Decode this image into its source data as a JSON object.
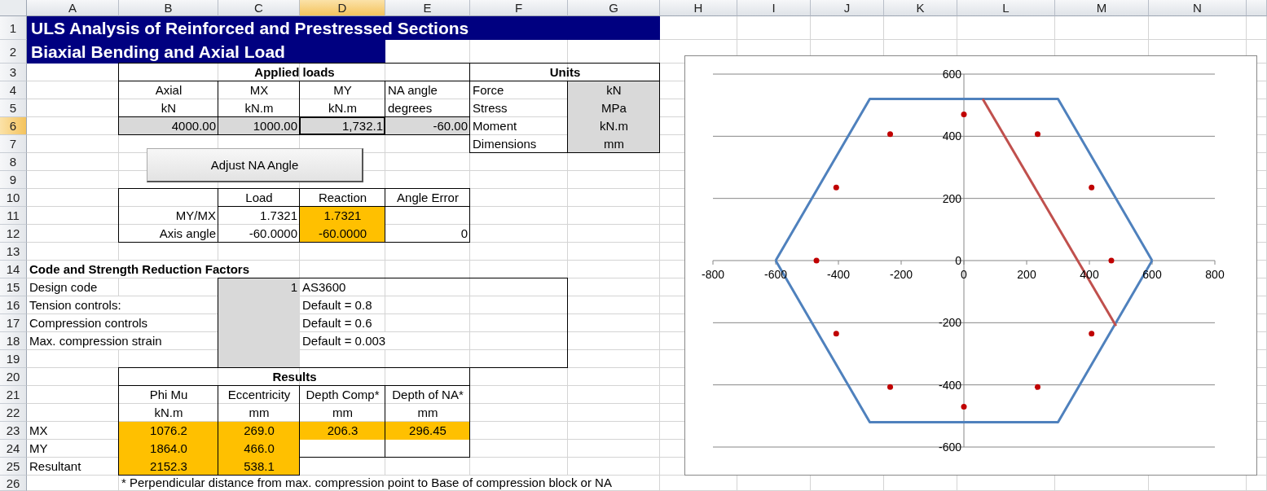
{
  "column_headers": [
    {
      "label": "A",
      "selected": false
    },
    {
      "label": "B",
      "selected": false
    },
    {
      "label": "C",
      "selected": false
    },
    {
      "label": "D",
      "selected": true
    },
    {
      "label": "E",
      "selected": false
    },
    {
      "label": "F",
      "selected": false
    },
    {
      "label": "G",
      "selected": false
    },
    {
      "label": "H",
      "selected": false
    },
    {
      "label": "I",
      "selected": false
    },
    {
      "label": "J",
      "selected": false
    },
    {
      "label": "K",
      "selected": false
    },
    {
      "label": "L",
      "selected": false
    },
    {
      "label": "M",
      "selected": false
    },
    {
      "label": "N",
      "selected": false
    }
  ],
  "rows": [
    {
      "label": "1",
      "selected": false,
      "cells": {
        "A": {
          "text": "ULS Analysis of Reinforced and Prestressed Sections",
          "kind": "title",
          "color": "#000080"
        },
        "B": {
          "kind": "merged"
        },
        "C": {
          "kind": "merged"
        },
        "D": {
          "kind": "merged"
        },
        "E": {
          "kind": "merged"
        },
        "F": {
          "kind": "merged"
        },
        "G": {
          "kind": "merged"
        }
      }
    },
    {
      "label": "2",
      "selected": false,
      "cells": {
        "A": {
          "text": "Biaxial Bending and Axial Load",
          "kind": "title",
          "color": "#000080"
        },
        "B": {
          "kind": "merged"
        },
        "C": {
          "kind": "merged"
        },
        "D": {
          "kind": "merged"
        }
      }
    },
    {
      "label": "3",
      "selected": false,
      "cells": {
        "B": {
          "text": "Applied loads",
          "kind": "heading"
        },
        "C": {
          "kind": "merged"
        },
        "D": {
          "kind": "merged"
        },
        "E": {
          "kind": "merged"
        },
        "F": {
          "text": "Units",
          "kind": "heading"
        },
        "G": {
          "kind": "merged"
        }
      }
    },
    {
      "label": "4",
      "selected": false,
      "cells": {
        "B": {
          "text": "Axial",
          "kind": "center"
        },
        "C": {
          "text": "MX",
          "kind": "center"
        },
        "D": {
          "text": "MY",
          "kind": "center"
        },
        "E": {
          "text": "NA angle",
          "kind": "left"
        },
        "F": {
          "text": "Force",
          "kind": "left"
        },
        "G": {
          "text": "kN",
          "kind": "center",
          "color": "#d9d9d9"
        }
      }
    },
    {
      "label": "5",
      "selected": false,
      "cells": {
        "B": {
          "text": "kN",
          "kind": "center"
        },
        "C": {
          "text": "kN.m",
          "kind": "center"
        },
        "D": {
          "text": "kN.m",
          "kind": "center"
        },
        "E": {
          "text": "degrees",
          "kind": "left"
        },
        "F": {
          "text": "Stress",
          "kind": "left"
        },
        "G": {
          "text": "MPa",
          "kind": "center",
          "color": "#d9d9d9"
        }
      }
    },
    {
      "label": "6",
      "selected": true,
      "cells": {
        "B": {
          "text": "4000.00",
          "kind": "right",
          "color": "#d9d9d9"
        },
        "C": {
          "text": "1000.00",
          "kind": "right",
          "color": "#d9d9d9"
        },
        "D": {
          "text": "1,732.1",
          "kind": "right",
          "color": "#d9d9d9"
        },
        "E": {
          "text": "-60.00",
          "kind": "right",
          "color": "#d9d9d9"
        },
        "F": {
          "text": "Moment",
          "kind": "left"
        },
        "G": {
          "text": "kN.m",
          "kind": "center",
          "color": "#d9d9d9"
        }
      }
    },
    {
      "label": "7",
      "selected": false,
      "cells": {
        "F": {
          "text": "Dimensions",
          "kind": "left"
        },
        "G": {
          "text": "mm",
          "kind": "center",
          "color": "#d9d9d9"
        }
      }
    },
    {
      "label": "8",
      "selected": false
    },
    {
      "label": "9",
      "selected": false
    },
    {
      "label": "10",
      "selected": false,
      "cells": {
        "C": {
          "text": "Load",
          "kind": "center"
        },
        "D": {
          "text": "Reaction",
          "kind": "center"
        },
        "E": {
          "text": "Angle Error",
          "kind": "center"
        }
      }
    },
    {
      "label": "11",
      "selected": false,
      "cells": {
        "B": {
          "text": "MY/MX",
          "kind": "right"
        },
        "C": {
          "text": "1.7321",
          "kind": "right"
        },
        "D": {
          "text": "1.7321",
          "kind": "center",
          "color": "#ffc000"
        }
      }
    },
    {
      "label": "12",
      "selected": false,
      "cells": {
        "B": {
          "text": "Axis angle",
          "kind": "right"
        },
        "C": {
          "text": "-60.0000",
          "kind": "right"
        },
        "D": {
          "text": "-60.0000",
          "kind": "center",
          "color": "#ffc000"
        },
        "E": {
          "text": "0",
          "kind": "right"
        }
      }
    },
    {
      "label": "13",
      "selected": false
    },
    {
      "label": "14",
      "selected": false,
      "cells": {
        "A": {
          "text": "Code and Strength Reduction Factors",
          "kind": "bold"
        }
      }
    },
    {
      "label": "15",
      "selected": false,
      "cells": {
        "A": {
          "text": "Design code",
          "kind": "left"
        },
        "C": {
          "text": "1",
          "kind": "right",
          "color": "#d9d9d9"
        },
        "D": {
          "text": "AS3600",
          "kind": "left"
        }
      }
    },
    {
      "label": "16",
      "selected": false,
      "cells": {
        "A": {
          "text": "Tension controls:",
          "kind": "left"
        },
        "C": {
          "kind": "blank",
          "color": "#d9d9d9"
        },
        "D": {
          "text": "Default = 0.8",
          "kind": "left"
        }
      }
    },
    {
      "label": "17",
      "selected": false,
      "cells": {
        "A": {
          "text": "Compression controls",
          "kind": "left"
        },
        "C": {
          "kind": "blank",
          "color": "#d9d9d9"
        },
        "D": {
          "text": "Default = 0.6",
          "kind": "left"
        }
      }
    },
    {
      "label": "18",
      "selected": false,
      "cells": {
        "A": {
          "text": "Max. compression strain",
          "kind": "left"
        },
        "C": {
          "kind": "blank",
          "color": "#d9d9d9"
        },
        "D": {
          "text": "Default = 0.003",
          "kind": "left"
        }
      }
    },
    {
      "label": "19",
      "selected": false,
      "cells": {
        "C": {
          "kind": "blank",
          "color": "#d9d9d9"
        }
      }
    },
    {
      "label": "20",
      "selected": false,
      "cells": {
        "B": {
          "text": "Results",
          "kind": "heading"
        },
        "C": {
          "kind": "merged"
        },
        "D": {
          "kind": "merged"
        },
        "E": {
          "kind": "merged"
        }
      }
    },
    {
      "label": "21",
      "selected": false,
      "cells": {
        "B": {
          "text": "Phi Mu",
          "kind": "center"
        },
        "C": {
          "text": "Eccentricity",
          "kind": "center"
        },
        "D": {
          "text": "Depth Comp*",
          "kind": "center"
        },
        "E": {
          "text": "Depth of NA*",
          "kind": "center"
        }
      }
    },
    {
      "label": "22",
      "selected": false,
      "cells": {
        "B": {
          "text": "kN.m",
          "kind": "center"
        },
        "C": {
          "text": "mm",
          "kind": "center"
        },
        "D": {
          "text": "mm",
          "kind": "center"
        },
        "E": {
          "text": "mm",
          "kind": "center"
        }
      }
    },
    {
      "label": "23",
      "selected": false,
      "cells": {
        "A": {
          "text": "MX",
          "kind": "left"
        },
        "B": {
          "text": "1076.2",
          "kind": "center",
          "color": "#ffc000"
        },
        "C": {
          "text": "269.0",
          "kind": "center",
          "color": "#ffc000"
        },
        "D": {
          "text": "206.3",
          "kind": "center",
          "color": "#ffc000"
        },
        "E": {
          "text": "296.45",
          "kind": "center",
          "color": "#ffc000"
        }
      }
    },
    {
      "label": "24",
      "selected": false,
      "cells": {
        "A": {
          "text": "MY",
          "kind": "left"
        },
        "B": {
          "text": "1864.0",
          "kind": "center",
          "color": "#ffc000"
        },
        "C": {
          "text": "466.0",
          "kind": "center",
          "color": "#ffc000"
        }
      }
    },
    {
      "label": "25",
      "selected": false,
      "cells": {
        "A": {
          "text": "Resultant",
          "kind": "left"
        },
        "B": {
          "text": "2152.3",
          "kind": "center",
          "color": "#ffc000"
        },
        "C": {
          "text": "538.1",
          "kind": "center",
          "color": "#ffc000"
        }
      }
    },
    {
      "label": "26",
      "selected": false,
      "cells": {
        "B": {
          "text": "* Perpendicular distance from max. compression point to Base of compression block or NA",
          "kind": "left"
        }
      }
    }
  ],
  "button": {
    "label": "Adjust NA Angle"
  },
  "chart": {
    "chart_data": {
      "type": "scatter",
      "grid": true,
      "xlim": [
        -800,
        800
      ],
      "ylim": [
        -600,
        600
      ],
      "xticks": [
        -800,
        -600,
        -400,
        -200,
        0,
        200,
        400,
        600,
        800
      ],
      "yticks": [
        -600,
        -400,
        -200,
        0,
        200,
        400,
        600
      ],
      "series": [
        {
          "type": "line",
          "color": "#4f81bd",
          "x": [
            -600,
            -300,
            300,
            600
          ],
          "values": [
            0,
            520,
            520,
            0
          ]
        },
        {
          "type": "line",
          "color": "#4f81bd",
          "x": [
            -600,
            -300,
            300,
            600
          ],
          "values": [
            0,
            -520,
            -520,
            0
          ]
        },
        {
          "type": "line",
          "color": "#c0504d",
          "x": [
            60,
            485
          ],
          "values": [
            520,
            -210
          ]
        },
        {
          "type": "scatter",
          "color": "#c00000",
          "x": [
            0,
            235,
            407,
            470,
            407,
            235,
            0,
            -235,
            -407,
            -470,
            -407,
            -235
          ],
          "values": [
            470,
            407,
            235,
            0,
            -235,
            -407,
            -470,
            -407,
            -235,
            0,
            235,
            407
          ]
        }
      ]
    }
  }
}
